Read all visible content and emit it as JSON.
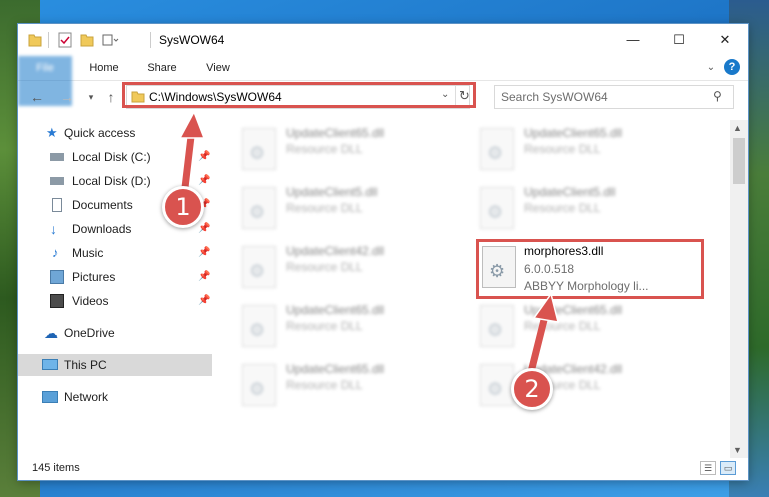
{
  "window": {
    "title": "SysWOW64"
  },
  "ribbon": {
    "tabs": [
      "File",
      "Home",
      "Share",
      "View"
    ]
  },
  "address": {
    "path": "C:\\Windows\\SysWOW64"
  },
  "search": {
    "placeholder": "Search SysWOW64"
  },
  "nav": {
    "quick_access": "Quick access",
    "items": [
      "Local Disk (C:)",
      "Local Disk (D:)",
      "Documents",
      "Downloads",
      "Music",
      "Pictures",
      "Videos"
    ],
    "onedrive": "OneDrive",
    "this_pc": "This PC",
    "network": "Network"
  },
  "files": [
    {
      "name": "UpdateClient65.dll",
      "type": "Resource DLL"
    },
    {
      "name": "UpdateClient65.dll",
      "type": "Resource DLL"
    },
    {
      "name": "UpdateClient5.dll",
      "type": "Resource DLL"
    },
    {
      "name": "UpdateClient5.dll",
      "type": "Resource DLL"
    },
    {
      "name": "UpdateClient42.dll",
      "type": "Resource DLL"
    },
    {
      "name": "UpdateClient65.dll",
      "type": "Resource DLL"
    },
    {
      "name": "UpdateClient65.dll",
      "type": "Resource DLL"
    },
    {
      "name": "UpdateClient65.dll",
      "type": "Resource DLL"
    },
    {
      "name": "UpdateClient42.dll",
      "type": "Resource DLL"
    }
  ],
  "highlighted_file": {
    "name": "morphores3.dll",
    "version": "6.0.0.518",
    "description": "ABBYY Morphology li..."
  },
  "status": {
    "count": "145 items"
  },
  "annotations": [
    "1",
    "2"
  ],
  "colors": {
    "accent": "#1979ca",
    "highlight": "#d9534f"
  }
}
